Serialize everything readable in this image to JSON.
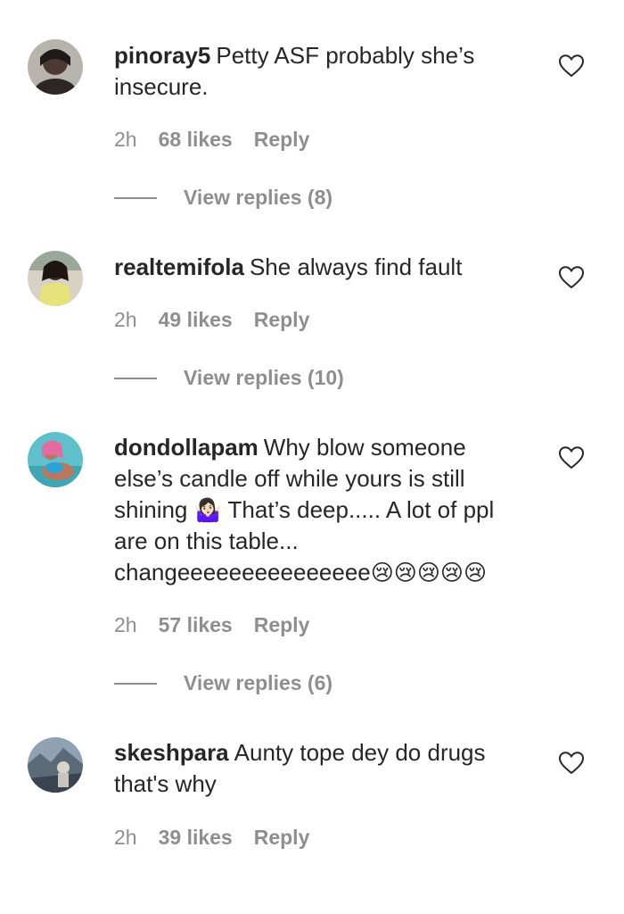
{
  "comments": [
    {
      "username": "pinoray5",
      "text": "Petty ASF probably she’s insecure.",
      "time": "2h",
      "likes": "68 likes",
      "reply": "Reply",
      "view_replies": "View replies (8)",
      "avatar_icon": "profile-photo-dark"
    },
    {
      "username": "realtemifola",
      "text": "She always find fault",
      "time": "2h",
      "likes": "49 likes",
      "reply": "Reply",
      "view_replies": "View replies (10)",
      "avatar_icon": "profile-photo-yellow-top"
    },
    {
      "username": "dondollapam",
      "text": "Why blow someone else’s candle off while yours is still shining",
      "emoji_1": "🤷🏻‍♀️",
      "text_2": "That’s deep..... A lot of ppl are on this table... changeeeeeeeeeeeeeee",
      "emoji_2": "😢😢😢😢😢",
      "time": "2h",
      "likes": "57 likes",
      "reply": "Reply",
      "view_replies": "View replies (6)",
      "avatar_icon": "profile-photo-teal-pink"
    },
    {
      "username": "skeshpara",
      "text": "Aunty tope dey do drugs that's why",
      "time": "2h",
      "likes": "39 likes",
      "reply": "Reply",
      "avatar_icon": "profile-photo-landscape"
    }
  ],
  "colors": {
    "text": "#262626",
    "secondary": "#8e8e8e",
    "background": "#ffffff"
  },
  "icons": {
    "like": "heart-outline-icon"
  }
}
